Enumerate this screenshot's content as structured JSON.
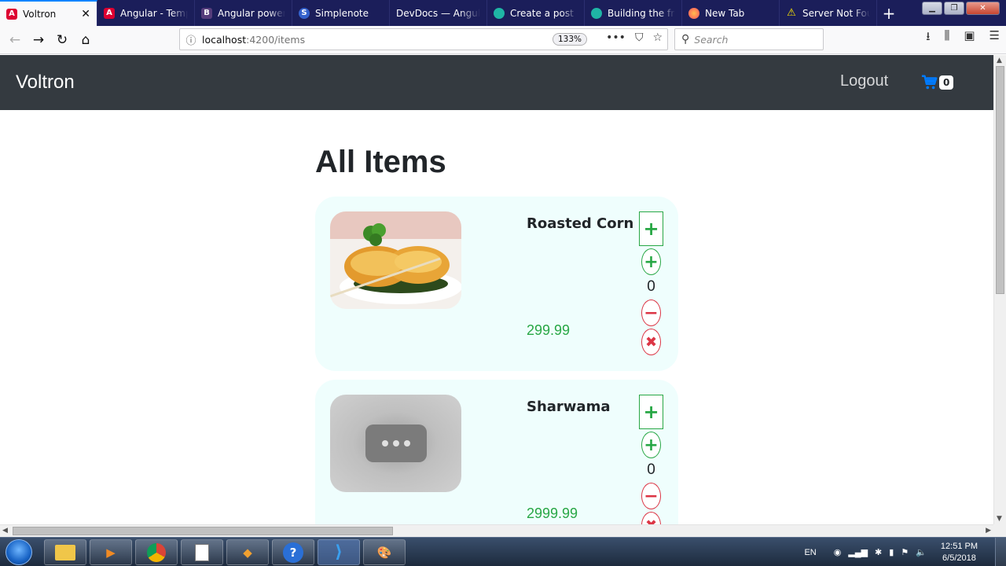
{
  "browser": {
    "tabs": [
      {
        "label": "Voltron",
        "icon": "angular-icon",
        "color": "#dd0031",
        "active": true
      },
      {
        "label": "Angular - Templ",
        "icon": "angular-icon",
        "color": "#dd0031"
      },
      {
        "label": "Angular powerec",
        "icon": "bootstrap-icon",
        "color": "#563d7c",
        "letter": "B"
      },
      {
        "label": "Simplenote",
        "icon": "simplenote-icon",
        "color": "#3361cc"
      },
      {
        "label": "DevDocs — Angular",
        "icon": "devdocs-icon",
        "color": "#333333"
      },
      {
        "label": "Create a post — ",
        "icon": "ghost-icon",
        "color": "#1fb5a5"
      },
      {
        "label": "Building the fron",
        "icon": "ghost-icon",
        "color": "#1fb5a5"
      },
      {
        "label": "New Tab",
        "icon": "firefox-icon",
        "color": "#ff7139"
      },
      {
        "label": "Server Not Found",
        "icon": "warning-icon",
        "color": "#ffe900"
      }
    ],
    "url_host": "localhost",
    "url_path": ":4200/items",
    "zoom": "133%",
    "search_placeholder": "Search"
  },
  "app": {
    "brand": "Voltron",
    "logout": "Logout",
    "cart_count": "0",
    "heading": "All Items"
  },
  "items": [
    {
      "name": "Roasted Corn",
      "price": "299.99",
      "qty": "0",
      "image": "food"
    },
    {
      "name": "Sharwama",
      "price": "2999.99",
      "qty": "0",
      "image": "placeholder"
    }
  ],
  "colors": {
    "navbar": "#343a40",
    "card_bg": "#effefd",
    "success": "#28a745",
    "danger": "#dc3545",
    "cart": "#007bff"
  },
  "taskbar": {
    "language": "EN",
    "time": "12:51 PM",
    "date": "6/5/2018"
  }
}
